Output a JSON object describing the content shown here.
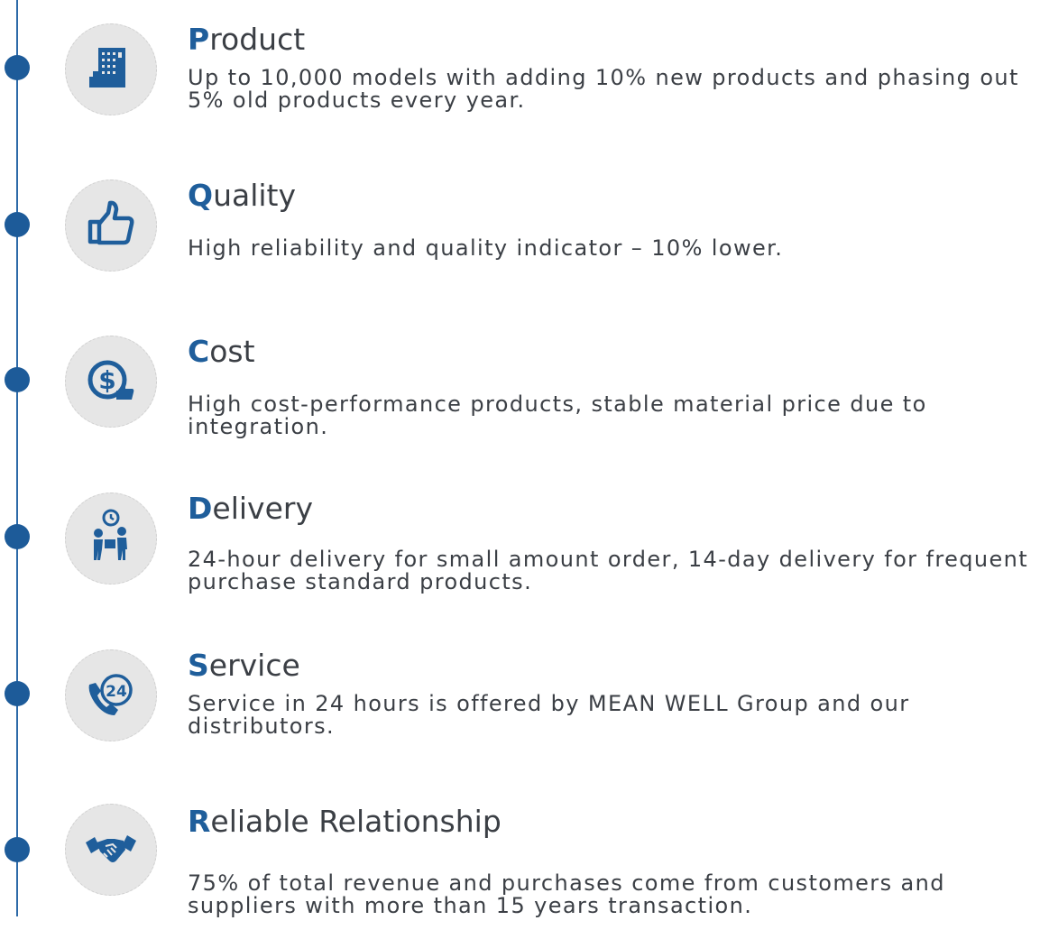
{
  "colors": {
    "accent": "#1f5e9b",
    "line": "#2d6aa8",
    "text": "#3b3f45",
    "circle": "#e6e6e6"
  },
  "items": [
    {
      "icon": "building-icon",
      "initial": "P",
      "rest": "roduct",
      "desc": "Up to 10,000 models with adding 10% new products and phasing out 5% old products every year."
    },
    {
      "icon": "thumbs-up-icon",
      "initial": "Q",
      "rest": "uality",
      "desc": "High reliability and quality indicator – 10% lower."
    },
    {
      "icon": "dollar-coin-icon",
      "initial": "C",
      "rest": "ost",
      "desc": "High cost-performance products, stable material price due to integration."
    },
    {
      "icon": "delivery-people-icon",
      "initial": "D",
      "rest": "elivery",
      "desc": "24-hour delivery for small amount order, 14-day delivery for frequent purchase standard products."
    },
    {
      "icon": "phone-24-icon",
      "initial": "S",
      "rest": "ervice",
      "desc": "Service in 24 hours is offered by MEAN WELL Group and our distributors."
    },
    {
      "icon": "handshake-icon",
      "initial": "R",
      "rest": "eliable Relationship",
      "desc": "75% of total revenue and purchases come from customers and suppliers with more than 15 years transaction."
    }
  ]
}
